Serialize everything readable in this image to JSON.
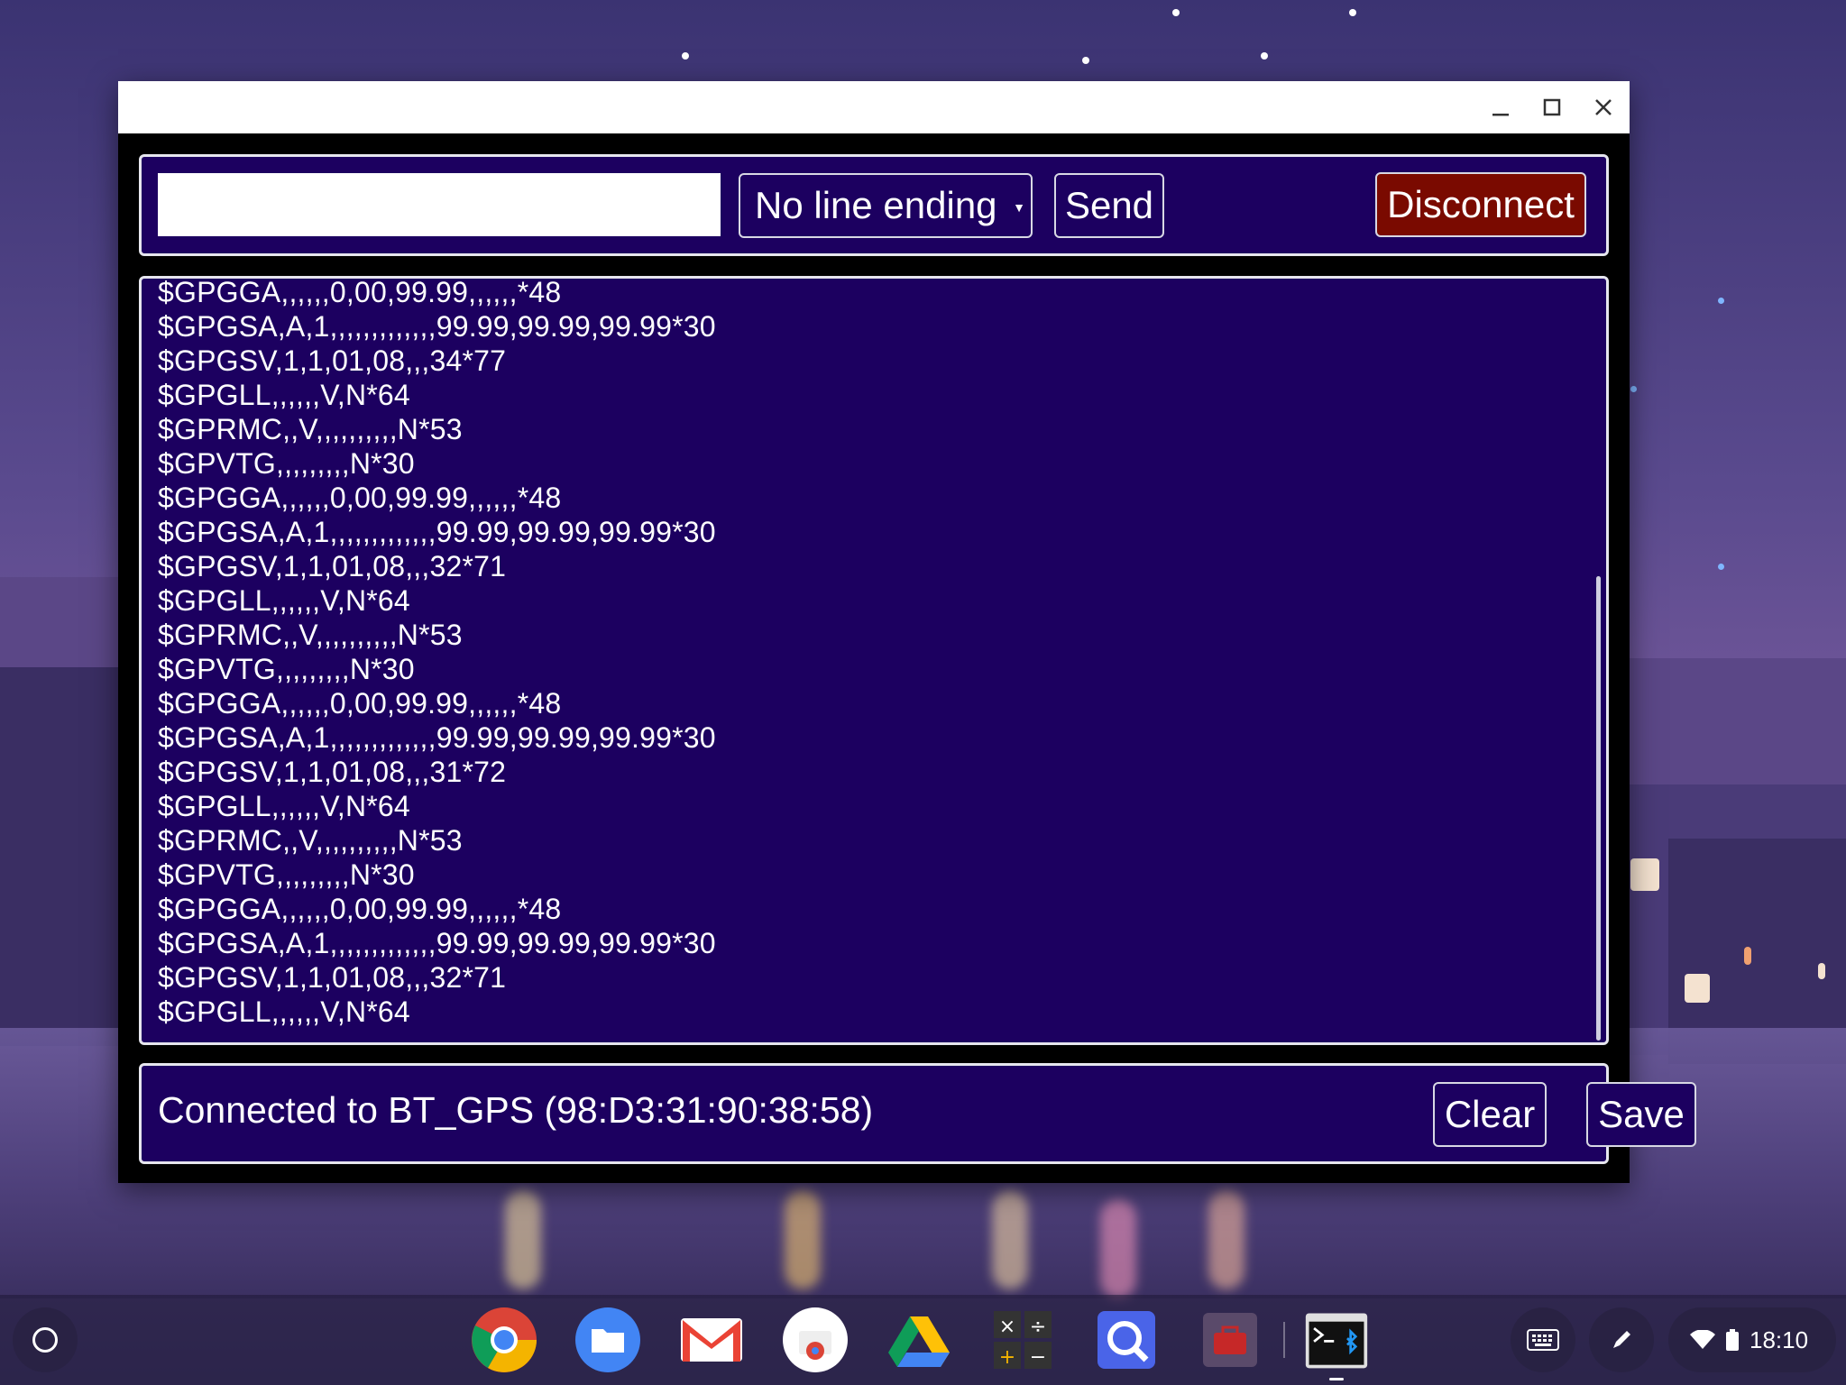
{
  "window": {
    "controls": [
      "minimize-icon",
      "maximize-icon",
      "close-icon"
    ]
  },
  "toolbar": {
    "input_value": "",
    "line_ending_selected": "No line ending",
    "send_label": "Send",
    "disconnect_label": "Disconnect"
  },
  "log": {
    "lines": [
      "$GPGGA,,,,,,0,00,99.99,,,,,,*48",
      "$GPGSA,A,1,,,,,,,,,,,,,99.99,99.99,99.99*30",
      "$GPGSV,1,1,01,08,,,34*77",
      "$GPGLL,,,,,,V,N*64",
      "$GPRMC,,V,,,,,,,,,,N*53",
      "$GPVTG,,,,,,,,,N*30",
      "$GPGGA,,,,,,0,00,99.99,,,,,,*48",
      "$GPGSA,A,1,,,,,,,,,,,,,99.99,99.99,99.99*30",
      "$GPGSV,1,1,01,08,,,32*71",
      "$GPGLL,,,,,,V,N*64",
      "$GPRMC,,V,,,,,,,,,,N*53",
      "$GPVTG,,,,,,,,,N*30",
      "$GPGGA,,,,,,0,00,99.99,,,,,,*48",
      "$GPGSA,A,1,,,,,,,,,,,,,99.99,99.99,99.99*30",
      "$GPGSV,1,1,01,08,,,31*72",
      "$GPGLL,,,,,,V,N*64",
      "$GPRMC,,V,,,,,,,,,,N*53",
      "$GPVTG,,,,,,,,,N*30",
      "$GPGGA,,,,,,0,00,99.99,,,,,,*48",
      "$GPGSA,A,1,,,,,,,,,,,,,99.99,99.99,99.99*30",
      "$GPGSV,1,1,01,08,,,32*71",
      "$GPGLL,,,,,,V,N*64"
    ]
  },
  "status": {
    "text": "Connected to BT_GPS (98:D3:31:90:38:58)",
    "clear_label": "Clear",
    "save_label": "Save"
  },
  "colors": {
    "panel_bg": "#1c0060",
    "disconnect_bg": "#7a0a00",
    "window_bg": "#000000"
  },
  "shelf": {
    "apps": [
      "chrome-icon",
      "files-icon",
      "gmail-icon",
      "web-store-icon",
      "drive-icon",
      "calculator-icon",
      "search-app-icon",
      "toolbox-icon",
      "serial-terminal-icon"
    ],
    "tray": [
      "keyboard-icon",
      "stylus-icon",
      "wifi-icon",
      "battery-icon"
    ],
    "clock": "18:10"
  }
}
